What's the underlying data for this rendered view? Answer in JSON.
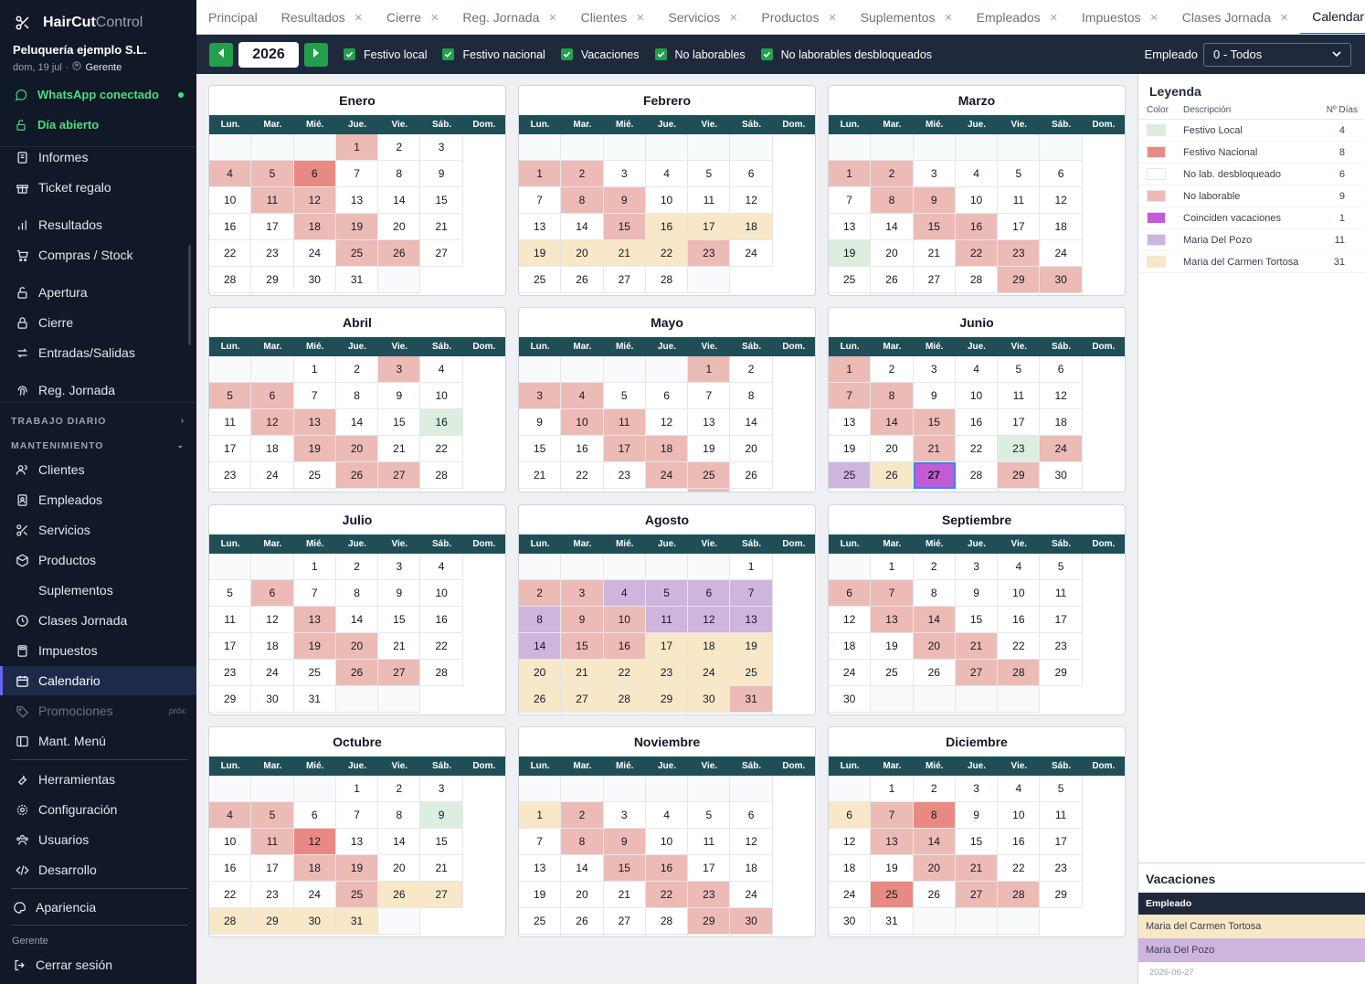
{
  "app": {
    "title_a": "HairCut",
    "title_b": "Control",
    "company": "Peluquería ejemplo S.L.",
    "date": "dom, 19 jul",
    "role": "Gerente",
    "whatsapp": "WhatsApp conectado",
    "day_status": "Día abierto"
  },
  "sidebar": {
    "group1": [
      "Informes",
      "Ticket regalo",
      "Resultados",
      "Compras / Stock",
      "Apertura",
      "Cierre",
      "Entradas/Salidas",
      "Reg. Jornada"
    ],
    "section_daily": "TRABAJO DIARIO",
    "section_maint": "MANTENIMIENTO",
    "maint": [
      "Clientes",
      "Empleados",
      "Servicios",
      "Productos",
      "Suplementos",
      "Clases Jornada",
      "Impuestos",
      "Calendario",
      "Promociones",
      "Mant. Menú"
    ],
    "soon": "próx.",
    "tools": [
      "Herramientas",
      "Configuración",
      "Usuarios",
      "Desarrollo"
    ],
    "appearance": "Apariencia",
    "footer_role": "Gerente",
    "logout": "Cerrar sesión"
  },
  "tabs": [
    "Principal",
    "Resultados",
    "Cierre",
    "Reg. Jornada",
    "Clientes",
    "Servicios",
    "Productos",
    "Suplementos",
    "Empleados",
    "Impuestos",
    "Clases Jornada",
    "Calendario"
  ],
  "toolbar": {
    "year": "2026",
    "checks": [
      "Festivo local",
      "Festivo nacional",
      "Vacaciones",
      "No laborables",
      "No laborables desbloqueados"
    ],
    "employee_label": "Empleado",
    "employee_value": "0 - Todos"
  },
  "weekdays": [
    "Lun.",
    "Mar.",
    "Mié.",
    "Jue.",
    "Vie.",
    "Sáb.",
    "Dom."
  ],
  "colors": {
    "nl": "#ecbbb6",
    "fn": "#e88a83",
    "fl": "#dcefdf",
    "vc": "#f8e8c8",
    "vp": "#cfb5dd",
    "co": "#c45bd6",
    "ub": "#ffffff"
  },
  "months": [
    {
      "name": "Enero",
      "offset": 3,
      "days": 31,
      "marks": {
        "1": "nl",
        "4": "nl",
        "5": "nl",
        "6": "fn",
        "11": "nl",
        "12": "nl",
        "18": "nl",
        "19": "nl",
        "25": "nl",
        "26": "nl"
      }
    },
    {
      "name": "Febrero",
      "offset": 6,
      "days": 28,
      "marks": {
        "1": "nl",
        "2": "nl",
        "8": "nl",
        "9": "nl",
        "15": "nl",
        "16": "vc",
        "17": "vc",
        "18": "vc",
        "19": "vc",
        "20": "vc",
        "21": "vc",
        "22": "vc",
        "23": "nl"
      }
    },
    {
      "name": "Marzo",
      "offset": 6,
      "days": 31,
      "marks": {
        "1": "nl",
        "2": "nl",
        "8": "nl",
        "9": "nl",
        "15": "nl",
        "16": "nl",
        "19": "fl",
        "22": "nl",
        "23": "nl",
        "29": "nl",
        "30": "nl"
      }
    },
    {
      "name": "Abril",
      "offset": 2,
      "days": 30,
      "marks": {
        "3": "nl",
        "5": "nl",
        "6": "nl",
        "12": "nl",
        "13": "nl",
        "16": "fl",
        "19": "nl",
        "20": "nl",
        "26": "nl",
        "27": "nl"
      }
    },
    {
      "name": "Mayo",
      "offset": 4,
      "days": 31,
      "marks": {
        "1": "nl",
        "3": "nl",
        "4": "nl",
        "10": "nl",
        "11": "nl",
        "17": "nl",
        "18": "nl",
        "24": "nl",
        "25": "nl",
        "31": "nl"
      }
    },
    {
      "name": "Junio",
      "offset": 0,
      "days": 30,
      "marks": {
        "1": "nl",
        "7": "nl",
        "8": "nl",
        "14": "nl",
        "15": "nl",
        "21": "nl",
        "23": "fl",
        "24": "nl",
        "25": "vp",
        "26": "vc",
        "27": "co",
        "29": "nl"
      }
    },
    {
      "name": "Julio",
      "offset": 2,
      "days": 31,
      "marks": {
        "6": "nl",
        "13": "nl",
        "19": "nl",
        "20": "nl",
        "26": "nl",
        "27": "nl"
      }
    },
    {
      "name": "Agosto",
      "offset": 5,
      "days": 31,
      "marks": {
        "2": "nl",
        "3": "nl",
        "4": "vp",
        "5": "vp",
        "6": "vp",
        "7": "vp",
        "8": "vp",
        "9": "nl",
        "10": "nl",
        "11": "vp",
        "12": "vp",
        "13": "vp",
        "14": "vp",
        "15": "nl",
        "16": "nl",
        "17": "vc",
        "18": "vc",
        "19": "vc",
        "20": "vc",
        "21": "vc",
        "22": "vc",
        "23": "vc",
        "24": "vc",
        "25": "vc",
        "26": "vc",
        "27": "vc",
        "28": "vc",
        "29": "vc",
        "30": "vc",
        "31": "nl"
      }
    },
    {
      "name": "Septiembre",
      "offset": 1,
      "days": 30,
      "marks": {
        "6": "nl",
        "7": "nl",
        "13": "nl",
        "14": "nl",
        "20": "nl",
        "21": "nl",
        "27": "nl",
        "28": "nl"
      }
    },
    {
      "name": "Octubre",
      "offset": 3,
      "days": 31,
      "marks": {
        "4": "nl",
        "5": "nl",
        "9": "fl",
        "11": "nl",
        "12": "fn",
        "18": "nl",
        "19": "nl",
        "25": "nl",
        "26": "vc",
        "27": "vc",
        "28": "vc",
        "29": "vc",
        "30": "vc",
        "31": "vc"
      }
    },
    {
      "name": "Noviembre",
      "offset": 6,
      "days": 30,
      "marks": {
        "1": "vc",
        "2": "nl",
        "8": "nl",
        "9": "nl",
        "15": "nl",
        "16": "nl",
        "22": "nl",
        "23": "nl",
        "29": "nl",
        "30": "nl"
      }
    },
    {
      "name": "Diciembre",
      "offset": 1,
      "days": 31,
      "marks": {
        "6": "vc",
        "7": "nl",
        "8": "fn",
        "13": "nl",
        "14": "nl",
        "20": "nl",
        "21": "nl",
        "25": "fn",
        "27": "nl",
        "28": "nl"
      }
    }
  ],
  "legend": {
    "title": "Leyenda",
    "headers": [
      "Color",
      "Descripción",
      "Nº Días"
    ],
    "rows": [
      {
        "color": "#dcefdf",
        "label": "Festivo Local",
        "count": "4"
      },
      {
        "color": "#e88a83",
        "label": "Festivo Nacional",
        "count": "8"
      },
      {
        "color": "#ffffff",
        "label": "No lab. desbloqueado",
        "count": "6"
      },
      {
        "color": "#ecbbb6",
        "label": "No laborable",
        "count": "9"
      },
      {
        "color": "#c45bd6",
        "label": "Coinciden vacaciones",
        "count": "1"
      },
      {
        "color": "#cfb5dd",
        "label": "Maria Del Pozo",
        "count": "11"
      },
      {
        "color": "#f8e8c8",
        "label": "Maria del Carmen Tortosa",
        "count": "31"
      }
    ]
  },
  "vacations": {
    "title": "Vacaciones",
    "header": "Empleado",
    "rows": [
      {
        "name": "Maria del Carmen Tortosa",
        "color": "#f8e8c8"
      },
      {
        "name": "Maria Del Pozo",
        "color": "#cfb5dd"
      }
    ],
    "date": "2026-06-27"
  }
}
